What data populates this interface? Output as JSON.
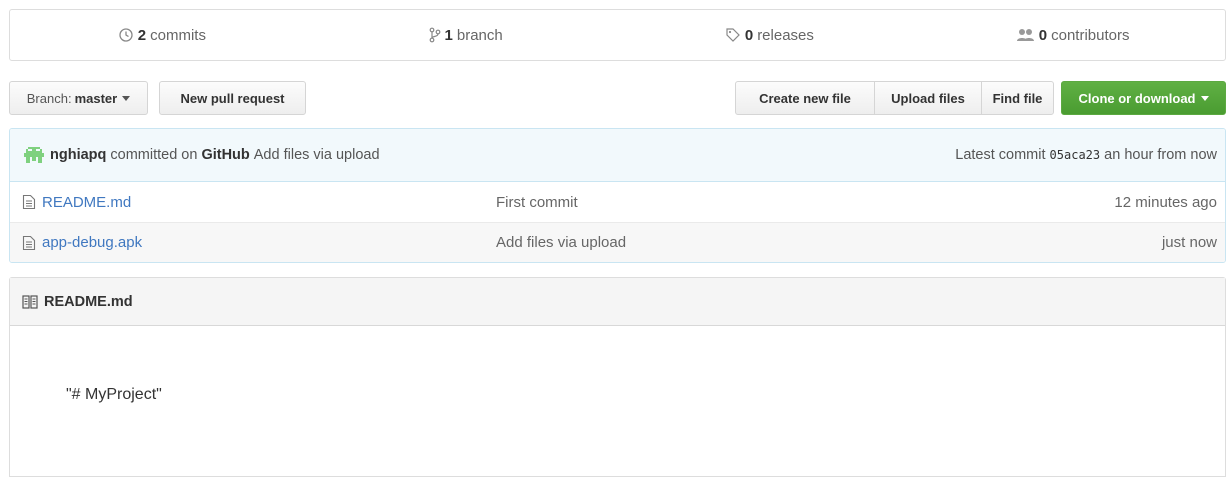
{
  "summary": {
    "commits": {
      "count": "2",
      "label": "commits",
      "icon": "history-icon"
    },
    "branches": {
      "count": "1",
      "label": "branch",
      "icon": "git-branch-icon"
    },
    "releases": {
      "count": "0",
      "label": "releases",
      "icon": "tag-icon"
    },
    "contributors": {
      "count": "0",
      "label": "contributors",
      "icon": "people-icon"
    }
  },
  "toolbar": {
    "branch_prefix": "Branch:",
    "branch_name": "master",
    "new_pull_request": "New pull request",
    "create_new_file": "Create new file",
    "upload_files": "Upload files",
    "find_file": "Find file",
    "clone_or_download": "Clone or download"
  },
  "commit": {
    "author": "nghiapq",
    "committed_on": "committed on",
    "committer": "GitHub",
    "message": "Add files via upload",
    "latest_label": "Latest commit",
    "sha": "05aca23",
    "time": "an hour from now"
  },
  "files": [
    {
      "name": "README.md",
      "message": "First commit",
      "age": "12 minutes ago",
      "icon": "file-text-icon"
    },
    {
      "name": "app-debug.apk",
      "message": "Add files via upload",
      "age": "just now",
      "icon": "file-text-icon"
    }
  ],
  "readme": {
    "title": "README.md",
    "icon": "book-icon",
    "content": "\"# MyProject\""
  },
  "colors": {
    "link": "#4078c0",
    "clone_button": "#55a532",
    "commit_tease_bg": "#f2f9fc"
  }
}
